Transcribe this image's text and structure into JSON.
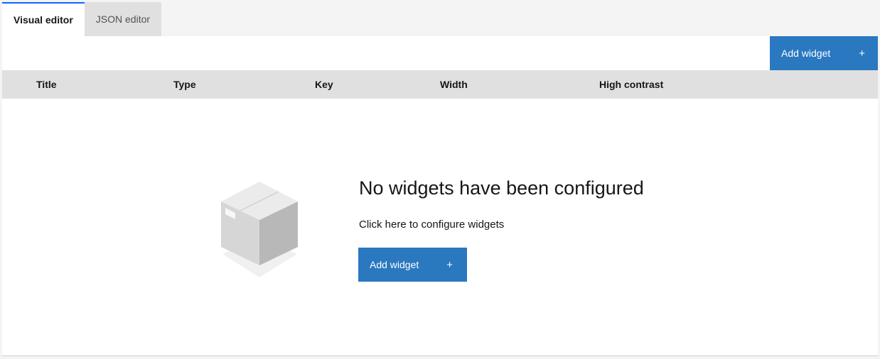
{
  "tabs": [
    {
      "label": "Visual editor",
      "active": true
    },
    {
      "label": "JSON editor",
      "active": false
    }
  ],
  "toolbar": {
    "add_widget_label": "Add widget",
    "add_icon": "+"
  },
  "table": {
    "columns": [
      "Title",
      "Type",
      "Key",
      "Width",
      "High contrast"
    ]
  },
  "empty_state": {
    "title": "No widgets have been configured",
    "description": "Click here to configure widgets",
    "button_label": "Add widget",
    "button_icon": "+",
    "illustration": "box-icon"
  },
  "colors": {
    "accent": "#2a78c0",
    "tab_indicator": "#0f62fe",
    "header_bg": "#e0e0e0"
  }
}
